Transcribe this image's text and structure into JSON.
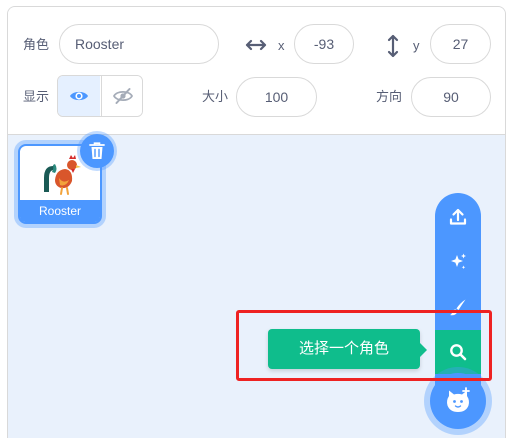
{
  "sprite_info": {
    "sprite_label": "角色",
    "sprite_name": "Rooster",
    "x_label": "x",
    "x_value": "-93",
    "y_label": "y",
    "y_value": "27",
    "show_label": "显示",
    "size_label": "大小",
    "size_value": "100",
    "direction_label": "方向",
    "direction_value": "90",
    "visibility": "shown"
  },
  "sprites": [
    {
      "name": "Rooster",
      "selected": true
    }
  ],
  "sprite_menu": {
    "items": [
      {
        "icon": "upload-icon"
      },
      {
        "icon": "surprise-icon"
      },
      {
        "icon": "paint-icon"
      },
      {
        "icon": "search-icon",
        "active": true
      }
    ],
    "main_icon": "cat-icon",
    "tooltip": "选择一个角色"
  },
  "colors": {
    "accent": "#4c97ff",
    "active": "#0fbd8c",
    "highlight": "#ee2222",
    "panel_bg": "#e9f1fc"
  }
}
